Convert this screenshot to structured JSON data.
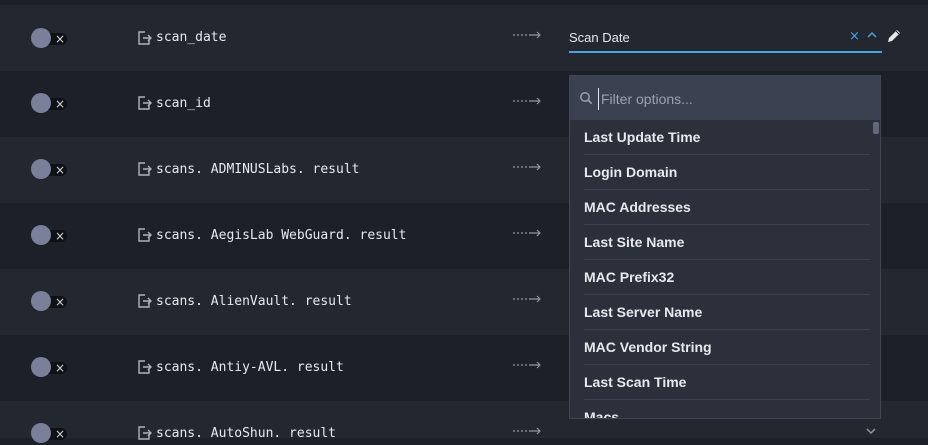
{
  "rows": [
    {
      "field": "scan_date"
    },
    {
      "field": "scan_id"
    },
    {
      "field": "scans. ADMINUSLabs. result"
    },
    {
      "field": "scans. AegisLab WebGuard. result"
    },
    {
      "field": "scans. AlienVault. result"
    },
    {
      "field": "scans. Antiy-AVL. result"
    },
    {
      "field": "scans. AutoShun. result"
    }
  ],
  "toggle": {
    "off_symbol": "×"
  },
  "mapping": {
    "selected": "Scan Date",
    "clear_symbol": "×"
  },
  "dropdown": {
    "filter_placeholder": "Filter options...",
    "options": [
      "Last Update Time",
      "Login Domain",
      "MAC Addresses",
      "Last Site Name",
      "MAC Prefix32",
      "Last Server Name",
      "MAC Vendor String",
      "Last Scan Time",
      "Macs"
    ]
  },
  "icons": {
    "toggle": "toggle-switch",
    "field": "field-export-icon",
    "arrow": "mapping-arrow-icon",
    "clear": "close-icon",
    "chevron": "chevron-up-icon",
    "edit": "pencil-icon",
    "search": "search-icon"
  },
  "colors": {
    "accent": "#4aa3df",
    "row_a": "#23272f",
    "row_b": "#1c2028",
    "dropdown": "#2b303a"
  }
}
